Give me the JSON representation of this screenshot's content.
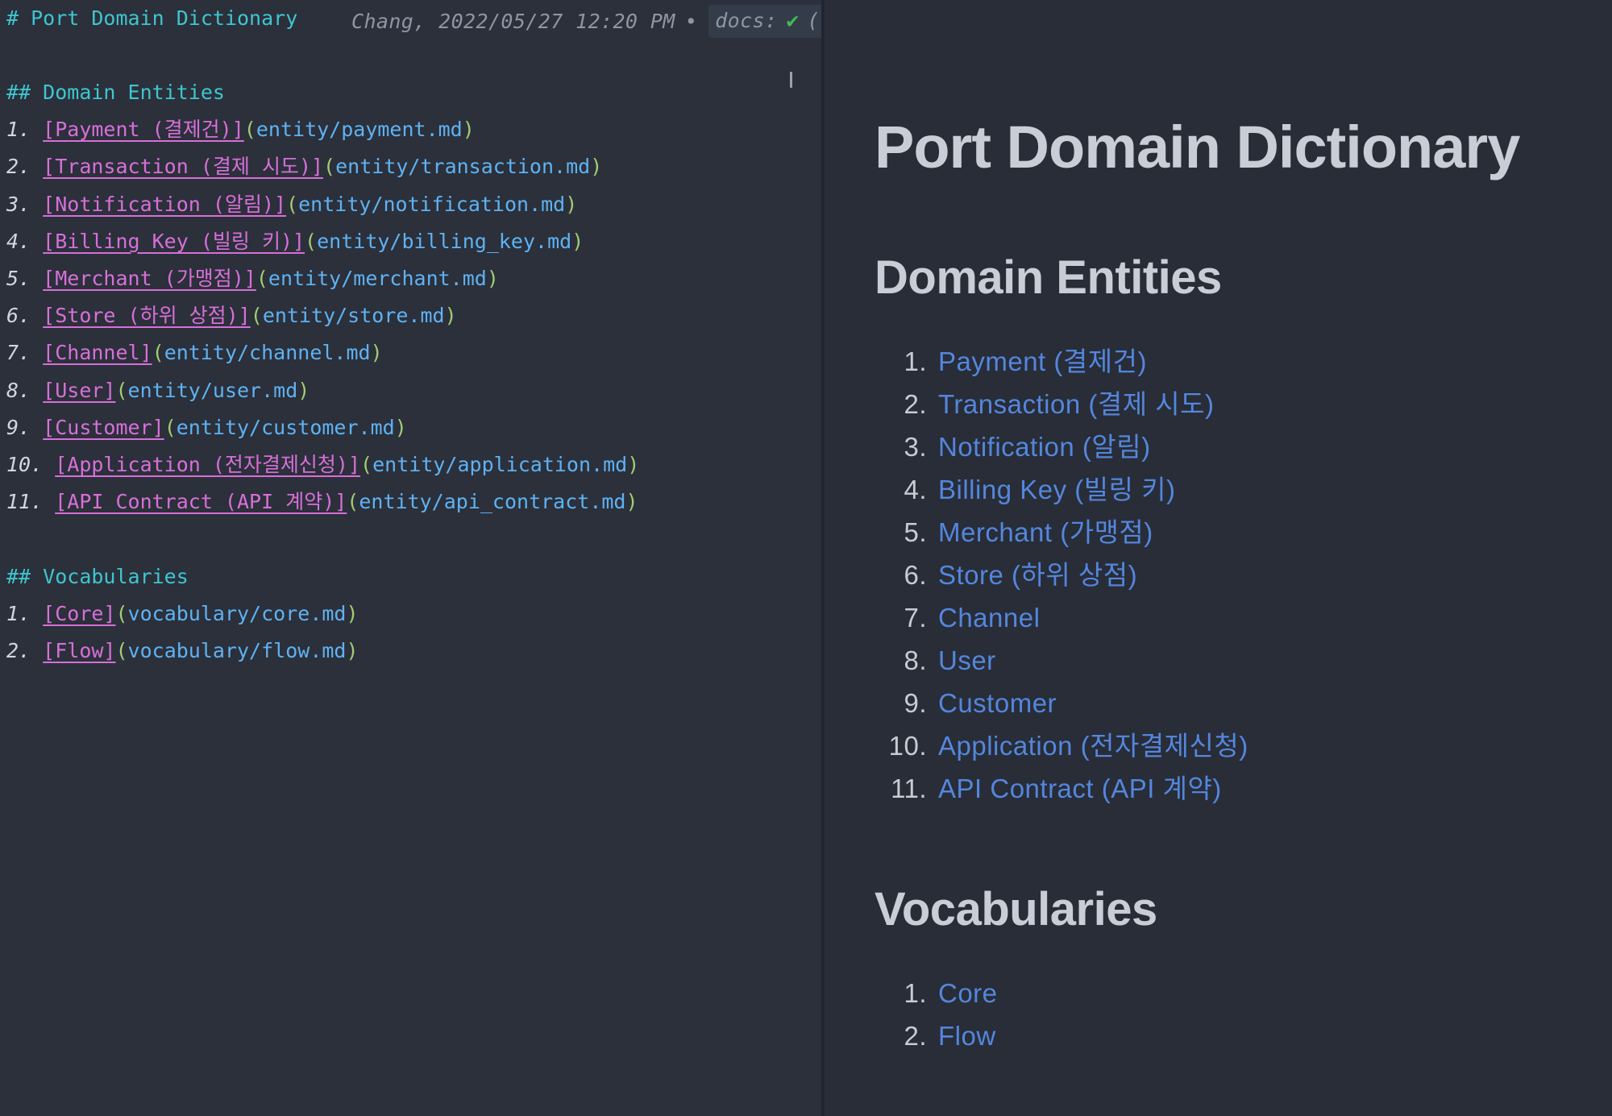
{
  "colors": {
    "editor_bg": "#2b303b",
    "preview_bg": "#282d38",
    "divider": "#202531",
    "chip_bg": "#343b49",
    "teal": "#3ec6cf",
    "magenta": "#d86fd8",
    "green": "#a2cd71",
    "blue": "#5fb2f2",
    "meta_gray": "#8e96a3",
    "num_white": "#d2d6de",
    "caret": "#9aa2b0",
    "check_green": "#44b854",
    "pv_heading": "#c9ced6",
    "pv_num": "#c7cbd2",
    "pv_link": "#5486dc"
  },
  "doc": {
    "title": "Port Domain Dictionary",
    "sections": [
      {
        "title": "Domain Entities",
        "items": [
          {
            "num": "1.",
            "label": "Payment (결제건)",
            "path": "entity/payment.md"
          },
          {
            "num": "2.",
            "label": "Transaction (결제 시도)",
            "path": "entity/transaction.md"
          },
          {
            "num": "3.",
            "label": "Notification (알림)",
            "path": "entity/notification.md"
          },
          {
            "num": "4.",
            "label": "Billing Key (빌링 키)",
            "path": "entity/billing_key.md"
          },
          {
            "num": "5.",
            "label": "Merchant (가맹점)",
            "path": "entity/merchant.md"
          },
          {
            "num": "6.",
            "label": "Store (하위 상점)",
            "path": "entity/store.md"
          },
          {
            "num": "7.",
            "label": "Channel",
            "path": "entity/channel.md"
          },
          {
            "num": "8.",
            "label": "User",
            "path": "entity/user.md"
          },
          {
            "num": "9.",
            "label": "Customer",
            "path": "entity/customer.md"
          },
          {
            "num": "10.",
            "label": "Application (전자결제신청)",
            "path": "entity/application.md"
          },
          {
            "num": "11.",
            "label": "API Contract (API 계약)",
            "path": "entity/api_contract.md"
          }
        ]
      },
      {
        "title": "Vocabularies",
        "items": [
          {
            "num": "1.",
            "label": "Core",
            "path": "vocabulary/core.md"
          },
          {
            "num": "2.",
            "label": "Flow",
            "path": "vocabulary/flow.md"
          }
        ]
      }
    ]
  },
  "editor": {
    "h1_marker": "#",
    "h2_marker": "##",
    "meta": {
      "author_date": "Chang, 2022/05/27 12:20 PM",
      "bullet": "•",
      "docs_label": "docs:",
      "check_glyph": "✔",
      "trailing_paren": "("
    }
  },
  "markdown_syntax": {
    "bracket_open": "[",
    "bracket_close": "]",
    "paren_open": "(",
    "paren_close": ")"
  }
}
